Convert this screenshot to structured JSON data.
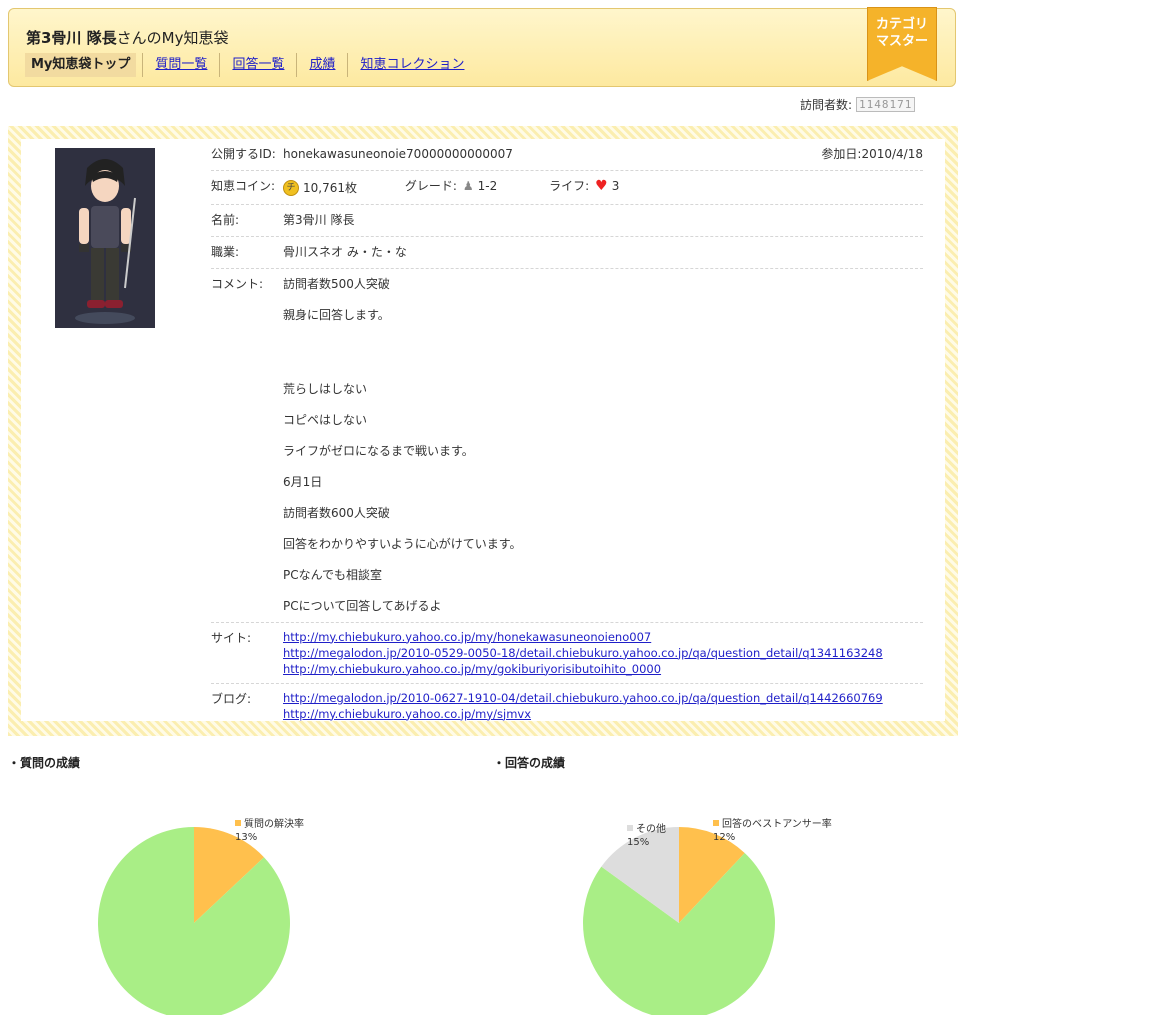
{
  "header": {
    "name": "第3骨川  隊長",
    "suffix": "さんのMy知恵袋",
    "nav": [
      {
        "label": "My知恵袋トップ",
        "active": true
      },
      {
        "label": "質問一覧"
      },
      {
        "label": "回答一覧"
      },
      {
        "label": "成績"
      },
      {
        "label": "知恵コレクション"
      }
    ],
    "badge_line1": "カテゴリ",
    "badge_line2": "マスター"
  },
  "visitors": {
    "label": "訪問者数:",
    "count": "1148171"
  },
  "profile": {
    "id_label": "公開するID:",
    "id_value": "honekawasuneonoie70000000000007",
    "join_label": "参加日:",
    "join_value": "2010/4/18",
    "coin_label": "知恵コイン:",
    "coin_value": "10,761枚",
    "grade_label": "グレード:",
    "grade_value": "1-2",
    "life_label": "ライフ:",
    "life_value": "3",
    "name_label": "名前:",
    "name_value": "第3骨川  隊長",
    "job_label": "職業:",
    "job_value": "骨川スネオ  み・た・な",
    "comment_label": "コメント:",
    "comment_lines": [
      "訪問者数500人突破",
      "親身に回答します。",
      "",
      "荒らしはしない",
      "コピペはしない",
      "ライフがゼロになるまで戦います。",
      "6月1日",
      "訪問者数600人突破",
      "回答をわかりやすいように心がけています。",
      "PCなんでも相談室",
      "PCについて回答してあげるよ"
    ],
    "site_label": "サイト:",
    "site_links": [
      "http://my.chiebukuro.yahoo.co.jp/my/honekawasuneonoieno007",
      "http://megalodon.jp/2010-0529-0050-18/detail.chiebukuro.yahoo.co.jp/qa/question_detail/q1341163248",
      "http://my.chiebukuro.yahoo.co.jp/my/gokiburiyorisibutoihito_0000"
    ],
    "blog_label": "ブログ:",
    "blog_links": [
      "http://megalodon.jp/2010-0627-1910-04/detail.chiebukuro.yahoo.co.jp/qa/question_detail/q1442660769",
      "http://my.chiebukuro.yahoo.co.jp/my/sjmvx"
    ]
  },
  "stats": {
    "question_title": "・質問の成績",
    "answer_title": "・回答の成績"
  },
  "chart_data": [
    {
      "type": "pie",
      "title": "・質問の成績",
      "slices": [
        {
          "name": "質問の解決率",
          "value": 13,
          "label": "13%",
          "color": "#ffc04d"
        },
        {
          "name": "",
          "value": 87,
          "label": "",
          "color": "#a9ee86"
        }
      ]
    },
    {
      "type": "pie",
      "title": "・回答の成績",
      "slices": [
        {
          "name": "回答のベストアンサー率",
          "value": 12,
          "label": "12%",
          "color": "#ffc04d"
        },
        {
          "name": "",
          "value": 73,
          "label": "",
          "color": "#a9ee86"
        },
        {
          "name": "その他",
          "value": 15,
          "label": "15%",
          "color": "#dddddd"
        }
      ]
    }
  ]
}
